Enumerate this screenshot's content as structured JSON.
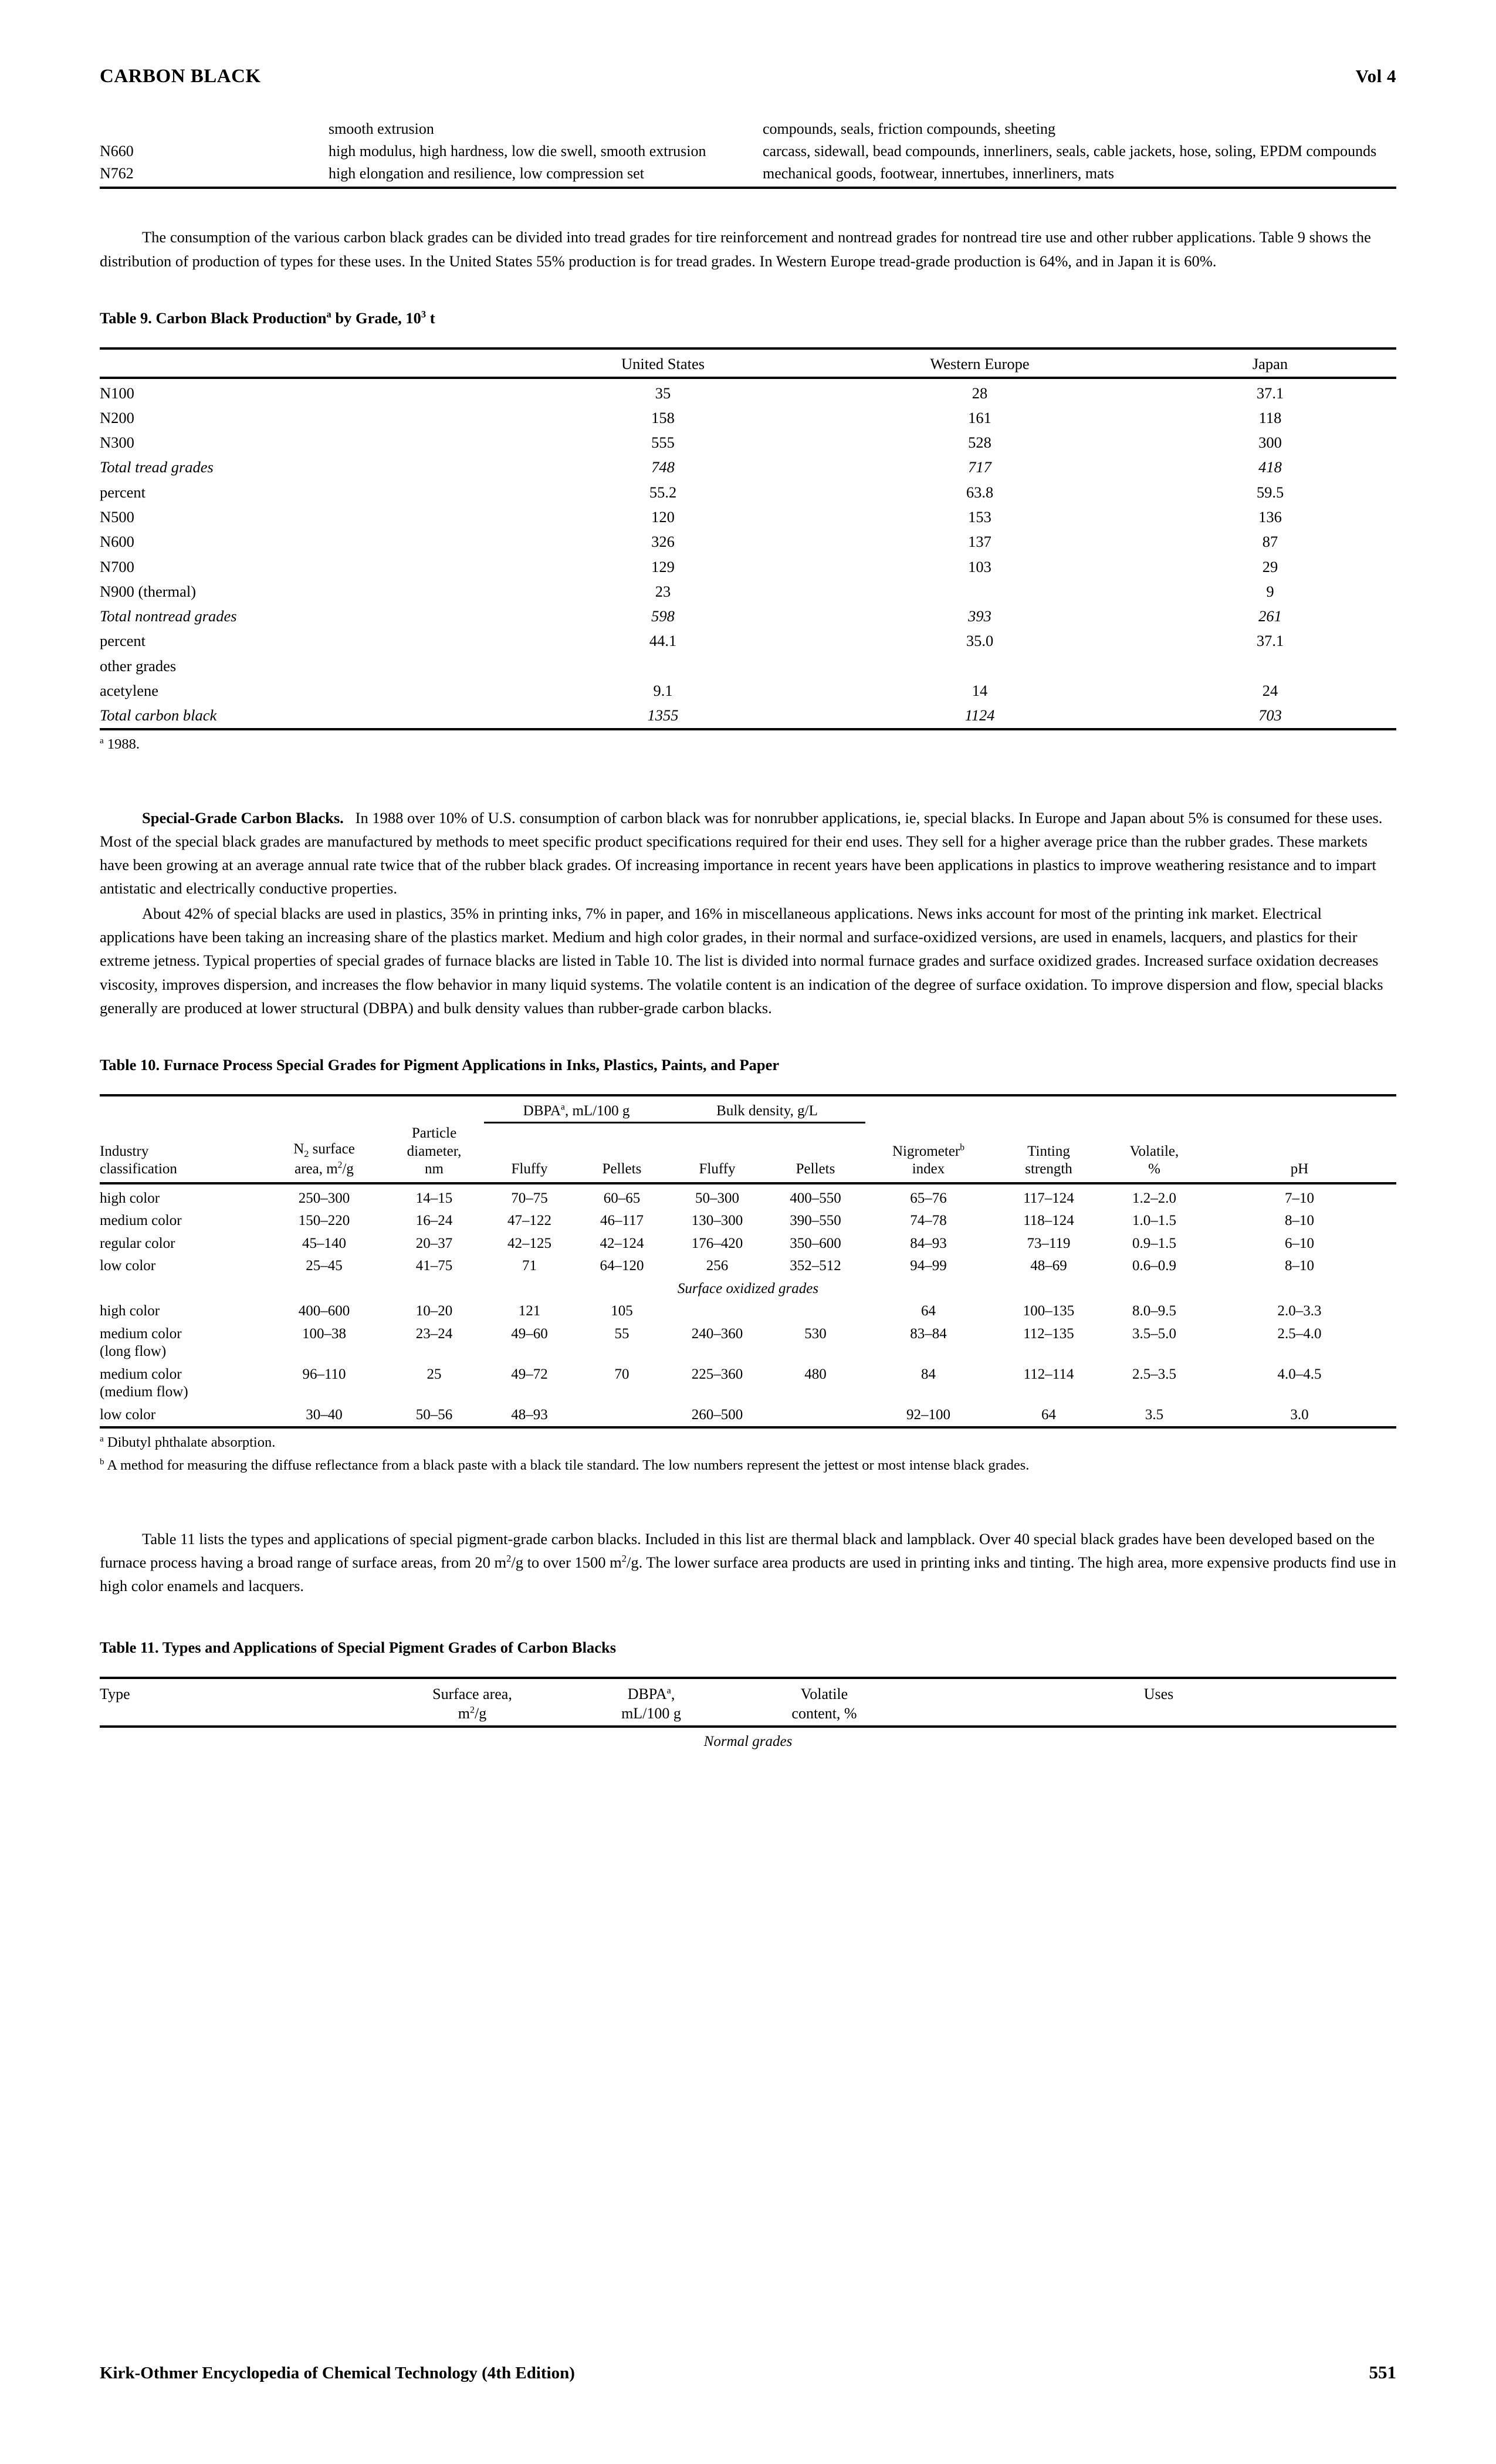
{
  "running_head": {
    "title": "CARBON BLACK",
    "volume": "Vol 4"
  },
  "footer": {
    "source": "Kirk-Othmer Encyclopedia of Chemical Technology (4th Edition)",
    "page": "551"
  },
  "continued_table": {
    "rows": [
      {
        "grade": "",
        "properties": "smooth extrusion",
        "applications": "compounds, seals, friction compounds, sheeting"
      },
      {
        "grade": "N660",
        "properties": "high modulus, high hardness, low die swell, smooth extrusion",
        "applications": "carcass, sidewall, bead compounds, innerliners, seals, cable jackets, hose, soling, EPDM compounds"
      },
      {
        "grade": "N762",
        "properties": "high elongation and resilience, low compression set",
        "applications": "mechanical goods, footwear, innertubes, innerliners, mats"
      }
    ]
  },
  "paragraphs": {
    "p1": "The consumption of the various carbon black grades can be divided into tread grades for tire reinforcement and nontread grades for nontread tire use and other rubber applications. Table 9 shows the distribution of production of types for these uses. In the United States 55% production is for tread grades. In Western Europe tread-grade production is 64%, and in Japan it is 60%.",
    "p2_heading": "Special-Grade Carbon Blacks.",
    "p2": "In 1988 over 10% of U.S. consumption of carbon black was for nonrubber applications, ie, special blacks. In Europe and Japan about 5% is consumed for these uses. Most of the special black grades are manufactured by methods to meet specific product specifications required for their end uses. They sell for a higher average price than the rubber grades. These markets have been growing at an average annual rate twice that of the rubber black grades. Of increasing importance in recent years have been applications in plastics to improve weathering resistance and to impart antistatic and electrically conductive properties.",
    "p3": "About 42% of special blacks are used in plastics, 35% in printing inks, 7% in paper, and 16% in miscellaneous applications. News inks account for most of the printing ink market. Electrical applications have been taking an increasing share of the plastics market. Medium and high color grades, in their normal and surface-oxidized versions, are used in enamels, lacquers, and plastics for their extreme jetness. Typical properties of special grades of furnace blacks are listed in Table 10. The list is divided into normal furnace grades and surface oxidized grades. Increased surface oxidation decreases viscosity, improves dispersion, and increases the flow behavior in many liquid systems. The volatile content is an indication of the degree of surface oxidation. To improve dispersion and flow, special blacks generally are produced at lower structural (DBPA) and bulk density values than rubber-grade carbon blacks.",
    "p4_a": "Table 11 lists the types and applications of special pigment-grade carbon blacks. Included in this list are thermal black and lampblack. Over 40 special black grades have been developed based on the furnace process having a broad range of surface areas, from 20 m",
    "p4_b": "/g to over 1500 m",
    "p4_c": "/g. The lower surface area products are used in printing inks and tinting. The high area, more expensive products find use in high color enamels and lacquers.",
    "sup2": "2"
  },
  "table9": {
    "caption_pre": "Table 9. Carbon Black Production",
    "caption_sup": "a",
    "caption_post_a": " by Grade, 10",
    "caption_sup_exp": "3",
    "caption_post_b": " t",
    "columns": [
      "",
      "United States",
      "Western Europe",
      "Japan"
    ],
    "rows": [
      {
        "label": "N100",
        "italic": false,
        "us": "35",
        "we": "28",
        "jp": "37.1"
      },
      {
        "label": "N200",
        "italic": false,
        "us": "158",
        "we": "161",
        "jp": "118"
      },
      {
        "label": "N300",
        "italic": false,
        "us": "555",
        "we": "528",
        "jp": "300"
      },
      {
        "label": "Total tread grades",
        "italic": true,
        "us": "748",
        "we": "717",
        "jp": "418"
      },
      {
        "label": "percent",
        "italic": false,
        "us": "55.2",
        "we": "63.8",
        "jp": "59.5"
      },
      {
        "label": "N500",
        "italic": false,
        "us": "120",
        "we": "153",
        "jp": "136"
      },
      {
        "label": "N600",
        "italic": false,
        "us": "326",
        "we": "137",
        "jp": "87"
      },
      {
        "label": "N700",
        "italic": false,
        "us": "129",
        "we": "103",
        "jp": "29"
      },
      {
        "label": "N900 (thermal)",
        "italic": false,
        "us": "23",
        "we": "",
        "jp": "9"
      },
      {
        "label": "Total nontread grades",
        "italic": true,
        "us": "598",
        "we": "393",
        "jp": "261"
      },
      {
        "label": "percent",
        "italic": false,
        "us": "44.1",
        "we": "35.0",
        "jp": "37.1"
      },
      {
        "label": "other grades",
        "italic": false,
        "us": "",
        "we": "",
        "jp": ""
      },
      {
        "label": "acetylene",
        "italic": false,
        "us": "9.1",
        "we": "14",
        "jp": "24"
      },
      {
        "label": "Total carbon black",
        "italic": true,
        "us": "1355",
        "we": "1124",
        "jp": "703"
      }
    ],
    "footnote_sup": "a",
    "footnote": " 1988."
  },
  "table10": {
    "caption": "Table 10. Furnace Process Special Grades for Pigment Applications in Inks, Plastics, Paints, and Paper",
    "group_dbpa_pre": "DBPA",
    "group_dbpa_sup": "a",
    "group_dbpa_post": ", mL/100 g",
    "group_bulk": "Bulk density, g/L",
    "headers": {
      "industry_1": "Industry",
      "industry_2": "classification",
      "n2_1": "N",
      "n2_sub": "2",
      "n2_1b": " surface",
      "n2_2": "area, m",
      "n2_sup": "2",
      "n2_2b": "/g",
      "particle_1": "Particle",
      "particle_2": "diameter,",
      "particle_3": "nm",
      "dbpa_fluffy": "Fluffy",
      "dbpa_pellets": "Pellets",
      "bulk_fluffy": "Fluffy",
      "bulk_pellets": "Pellets",
      "nigro_1": "Nigrometer",
      "nigro_sup": "b",
      "nigro_2": "index",
      "tint_1": "Tinting",
      "tint_2": "strength",
      "vol_1": "Volatile,",
      "vol_2": "%",
      "ph": "pH"
    },
    "normal_rows": [
      {
        "label": "high color",
        "label2": "",
        "n2": "250–300",
        "pd": "14–15",
        "df": "70–75",
        "dp": "60–65",
        "bf": "50–300",
        "bp": "400–550",
        "nig": "65–76",
        "tint": "117–124",
        "vol": "1.2–2.0",
        "ph": "7–10"
      },
      {
        "label": "medium color",
        "label2": "",
        "n2": "150–220",
        "pd": "16–24",
        "df": "47–122",
        "dp": "46–117",
        "bf": "130–300",
        "bp": "390–550",
        "nig": "74–78",
        "tint": "118–124",
        "vol": "1.0–1.5",
        "ph": "8–10"
      },
      {
        "label": "regular color",
        "label2": "",
        "n2": "45–140",
        "pd": "20–37",
        "df": "42–125",
        "dp": "42–124",
        "bf": "176–420",
        "bp": "350–600",
        "nig": "84–93",
        "tint": "73–119",
        "vol": "0.9–1.5",
        "ph": "6–10"
      },
      {
        "label": "low color",
        "label2": "",
        "n2": "25–45",
        "pd": "41–75",
        "df": "71",
        "dp": "64–120",
        "bf": "256",
        "bp": "352–512",
        "nig": "94–99",
        "tint": "48–69",
        "vol": "0.6–0.9",
        "ph": "8–10"
      }
    ],
    "section_label": "Surface oxidized grades",
    "oxidized_rows": [
      {
        "label": "high color",
        "label2": "",
        "n2": "400–600",
        "pd": "10–20",
        "df": "121",
        "dp": "105",
        "bf": "",
        "bp": "",
        "nig": "64",
        "tint": "100–135",
        "vol": "8.0–9.5",
        "ph": "2.0–3.3"
      },
      {
        "label": "medium color",
        "label2": "(long flow)",
        "n2": "100–38",
        "pd": "23–24",
        "df": "49–60",
        "dp": "55",
        "bf": "240–360",
        "bp": "530",
        "nig": "83–84",
        "tint": "112–135",
        "vol": "3.5–5.0",
        "ph": "2.5–4.0"
      },
      {
        "label": "medium color",
        "label2": "(medium flow)",
        "n2": "96–110",
        "pd": "25",
        "df": "49–72",
        "dp": "70",
        "bf": "225–360",
        "bp": "480",
        "nig": "84",
        "tint": "112–114",
        "vol": "2.5–3.5",
        "ph": "4.0–4.5"
      },
      {
        "label": "low color",
        "label2": "",
        "n2": "30–40",
        "pd": "50–56",
        "df": "48–93",
        "dp": "",
        "bf": "260–500",
        "bp": "",
        "nig": "92–100",
        "tint": "64",
        "vol": "3.5",
        "ph": "3.0"
      }
    ],
    "footnote_a_sup": "a",
    "footnote_a": " Dibutyl phthalate absorption.",
    "footnote_b_sup": "b",
    "footnote_b": " A method for measuring the diffuse reflectance from a black paste with a black tile standard. The low numbers represent the jettest or most intense black grades."
  },
  "table11": {
    "caption": "Table 11. Types and Applications of Special Pigment Grades of Carbon Blacks",
    "headers": {
      "type": "Type",
      "surface_1": "Surface area,",
      "surface_2": "m",
      "surface_sup": "2",
      "surface_2b": "/g",
      "dbpa_1": "DBPA",
      "dbpa_sup": "a",
      "dbpa_1b": ",",
      "dbpa_2": "mL/100 g",
      "volatile_1": "Volatile",
      "volatile_2": "content, %",
      "uses": "Uses"
    },
    "section_label": "Normal grades"
  }
}
